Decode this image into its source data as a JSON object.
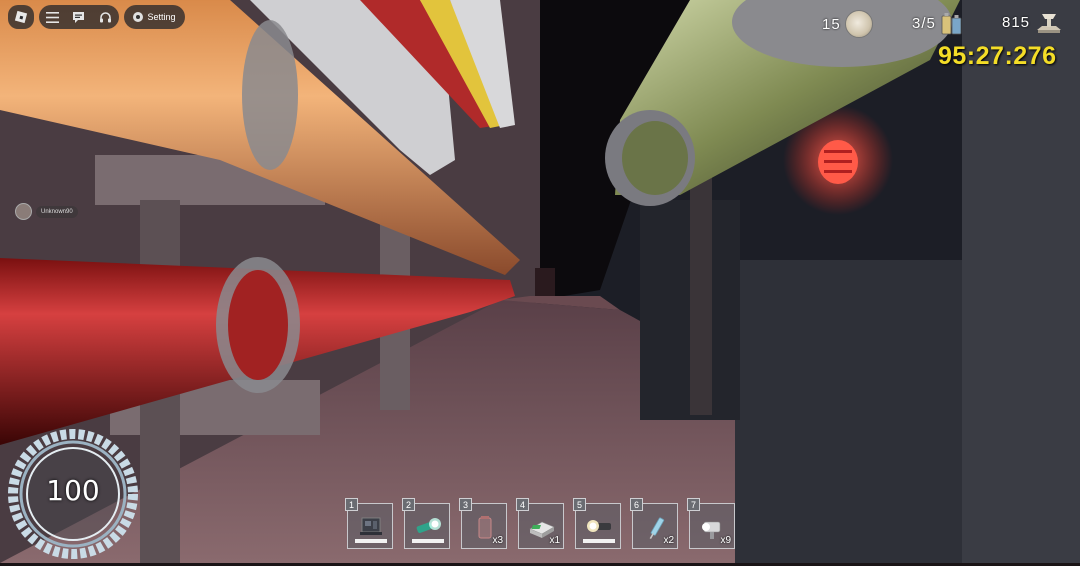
{
  "topbar": {
    "setting_label": "Setting"
  },
  "player": {
    "name": "Unknown90"
  },
  "stats": {
    "coins": "15",
    "batteries": "3/5",
    "score": "815",
    "timer": "95:27:276"
  },
  "health": {
    "value": "100"
  },
  "hotbar": {
    "slots": [
      {
        "number": "1",
        "icon": "generator-icon",
        "count": "",
        "bar_fraction": 1.0
      },
      {
        "number": "2",
        "icon": "flashlight-green-icon",
        "count": "",
        "bar_fraction": 1.0
      },
      {
        "number": "3",
        "icon": "glass-jar-icon",
        "count": "x3",
        "bar_fraction": null
      },
      {
        "number": "4",
        "icon": "first-aid-kit-icon",
        "count": "x1",
        "bar_fraction": null
      },
      {
        "number": "5",
        "icon": "flashlight-icon",
        "count": "",
        "bar_fraction": 1.0
      },
      {
        "number": "6",
        "icon": "syringe-icon",
        "count": "x2",
        "bar_fraction": null
      },
      {
        "number": "7",
        "icon": "lantern-icon",
        "count": "x9",
        "bar_fraction": null
      }
    ]
  },
  "colors": {
    "timer": "#f4dd27",
    "hud_text": "#ffffff",
    "warning_light": "#ff4a3a"
  }
}
